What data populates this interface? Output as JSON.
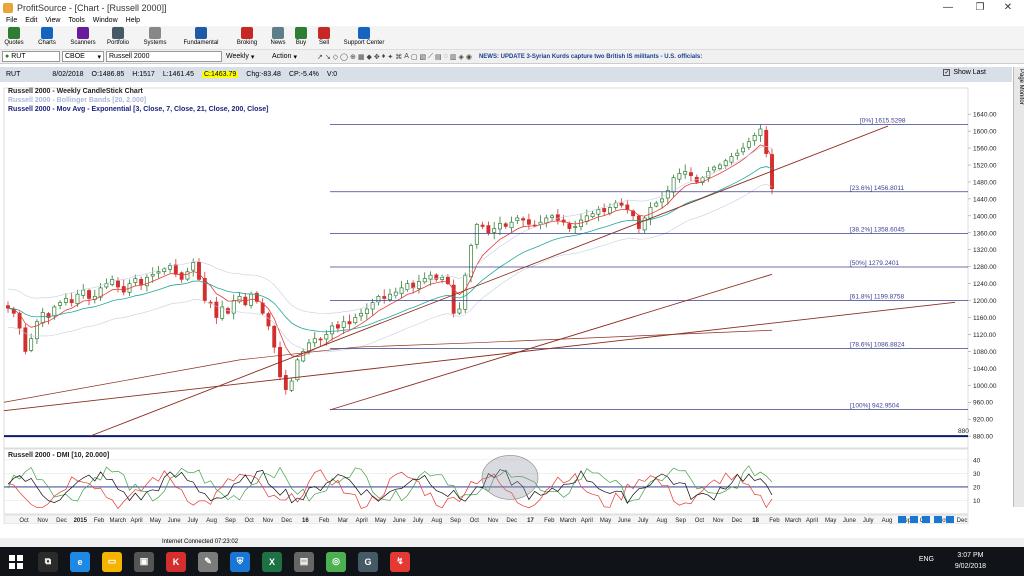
{
  "app": {
    "title": "ProfitSource - [Chart - [Russell 2000]]",
    "window_controls": [
      "—",
      "❐",
      "✕"
    ]
  },
  "menu": [
    "File",
    "Edit",
    "View",
    "Tools",
    "Window",
    "Help"
  ],
  "toolbar": [
    {
      "label": "Quotes",
      "icon": "quotes-icon",
      "color": "#2e7d32"
    },
    {
      "label": "Charts",
      "icon": "charts-icon",
      "color": "#1565c0"
    },
    {
      "label": "Scanners",
      "icon": "scanners-icon",
      "color": "#6a1b9a"
    },
    {
      "label": "Portfolio",
      "icon": "portfolio-icon",
      "color": "#455a64"
    },
    {
      "label": "Systems",
      "icon": "systems-icon",
      "color": "#888888"
    },
    {
      "label": "Fundamental",
      "icon": "fundamental-icon",
      "color": "#1e5aa8"
    },
    {
      "label": "Broking",
      "icon": "broking-icon",
      "color": "#c62828"
    },
    {
      "label": "News",
      "icon": "news-icon",
      "color": "#607d8b"
    },
    {
      "label": "Buy",
      "icon": "buy-icon",
      "color": "#2e7d32"
    },
    {
      "label": "Sell",
      "icon": "sell-icon",
      "color": "#c62828"
    },
    {
      "label": "Support Center",
      "icon": "support-icon",
      "color": "#1565c0"
    }
  ],
  "symbol_bar": {
    "symbol": "RUT",
    "exchange": "CBOE",
    "name": "Russell 2000",
    "period": "Weekly",
    "action": "Action",
    "news": "NEWS: UPDATE 3-Syrian Kurds capture two British IS militants - U.S. officials:"
  },
  "quote": {
    "symbol": "RUT",
    "date": "8/02/2018",
    "open": "O:1486.85",
    "high": "H:1517",
    "low": "L:1461.45",
    "close": "C:1463.79",
    "change": "Chg:-83.48",
    "change_pct": "CP:-5.4%",
    "volume": "V:0",
    "show_last": "Show Last"
  },
  "side_tab": "Page Monitor",
  "chart_data": {
    "type": "candlestick",
    "title": "Russell 2000 - Weekly CandleStick Chart",
    "legend": [
      {
        "text": "Russell 2000 - Bollinger Bands [20, 2.000]",
        "color": "#a9b8d6"
      },
      {
        "text": "Russell 2000 - Mov Avg - Exponential [3, Close, 7, Close, 21, Close, 200, Close]",
        "color": "#1a237e"
      }
    ],
    "y_ticks": [
      880,
      920,
      960,
      1000,
      1040,
      1080,
      1120,
      1160,
      1200,
      1240,
      1280,
      1320,
      1360,
      1400,
      1440,
      1480,
      1520,
      1560,
      1600,
      1640
    ],
    "ylim": [
      852,
      1664
    ],
    "marked_level": {
      "label": "880",
      "value": 880
    },
    "fib_levels": [
      {
        "label": "[0%] 1615.5298",
        "value": 1615.5298
      },
      {
        "label": "[23.6%] 1456.8011",
        "value": 1456.8011
      },
      {
        "label": "[38.2%] 1358.6045",
        "value": 1358.6045
      },
      {
        "label": "[50%] 1279.2401",
        "value": 1279.2401
      },
      {
        "label": "[61.8%] 1199.8758",
        "value": 1199.8758
      },
      {
        "label": "[78.6%] 1086.8824",
        "value": 1086.8824
      },
      {
        "label": "[100%] 942.9504",
        "value": 942.9504
      }
    ],
    "x_labels": [
      "Oct",
      "Nov",
      "Dec",
      "2015",
      "Feb",
      "March",
      "April",
      "May",
      "June",
      "July",
      "Aug",
      "Sep",
      "Oct",
      "Nov",
      "Dec",
      "16",
      "Feb",
      "Mar",
      "April",
      "May",
      "June",
      "July",
      "Aug",
      "Sep",
      "Oct",
      "Nov",
      "Dec",
      "17",
      "Feb",
      "March",
      "April",
      "May",
      "June",
      "July",
      "Aug",
      "Sep",
      "Oct",
      "Nov",
      "Dec",
      "18",
      "Feb",
      "March",
      "April",
      "May",
      "June",
      "July",
      "Aug",
      "Sep",
      "Oct",
      "Nov",
      "Dec"
    ],
    "closes": [
      1182,
      1170,
      1135,
      1080,
      1110,
      1150,
      1172,
      1160,
      1185,
      1195,
      1205,
      1195,
      1215,
      1225,
      1205,
      1210,
      1230,
      1240,
      1250,
      1232,
      1220,
      1240,
      1252,
      1238,
      1255,
      1262,
      1268,
      1275,
      1283,
      1262,
      1250,
      1268,
      1290,
      1250,
      1200,
      1195,
      1160,
      1185,
      1170,
      1200,
      1210,
      1190,
      1215,
      1198,
      1170,
      1140,
      1090,
      1020,
      990,
      1010,
      1060,
      1080,
      1100,
      1110,
      1108,
      1120,
      1140,
      1135,
      1150,
      1145,
      1160,
      1170,
      1180,
      1195,
      1210,
      1205,
      1215,
      1220,
      1230,
      1240,
      1230,
      1245,
      1252,
      1260,
      1250,
      1255,
      1240,
      1170,
      1180,
      1260,
      1330,
      1380,
      1375,
      1360,
      1370,
      1382,
      1375,
      1385,
      1395,
      1390,
      1380,
      1378,
      1385,
      1395,
      1400,
      1390,
      1385,
      1370,
      1375,
      1390,
      1400,
      1405,
      1415,
      1410,
      1420,
      1430,
      1425,
      1415,
      1400,
      1370,
      1395,
      1420,
      1430,
      1440,
      1460,
      1490,
      1500,
      1505,
      1495,
      1480,
      1490,
      1505,
      1515,
      1520,
      1530,
      1540,
      1548,
      1560,
      1575,
      1590,
      1605,
      1547,
      1464
    ],
    "dmi": {
      "title": "Russell 2000 - DMI [10, 20.000]",
      "y_ticks": [
        10,
        20,
        30,
        40
      ],
      "ylim": [
        0,
        48
      ]
    }
  },
  "status": {
    "text": "Internet Connected 07:23:02"
  },
  "taskbar": {
    "time": "3:07 PM",
    "date": "9/02/2018",
    "lang": "ENG",
    "apps": [
      {
        "icon": "task-view-icon",
        "color": "#2b2b2b"
      },
      {
        "icon": "edge-icon",
        "color": "#1e88e5"
      },
      {
        "icon": "folder-icon",
        "color": "#f4b400"
      },
      {
        "icon": "store-icon",
        "color": "#555555"
      },
      {
        "icon": "k-app-icon",
        "color": "#d32f2f"
      },
      {
        "icon": "paint-icon",
        "color": "#7b7b7b"
      },
      {
        "icon": "shield-app-icon",
        "color": "#1976d2"
      },
      {
        "icon": "excel-icon",
        "color": "#1e7145"
      },
      {
        "icon": "sticky-icon",
        "color": "#666666"
      },
      {
        "icon": "chrome-icon",
        "color": "#4caf50"
      },
      {
        "icon": "gr-app-icon",
        "color": "#455a64"
      },
      {
        "icon": "profitsource-icon",
        "color": "#e53935"
      }
    ],
    "app_glyphs": [
      "⧉",
      "e",
      "▭",
      "▣",
      "K",
      "✎",
      "⛨",
      "X",
      "▤",
      "◎",
      "G",
      "↯"
    ]
  }
}
